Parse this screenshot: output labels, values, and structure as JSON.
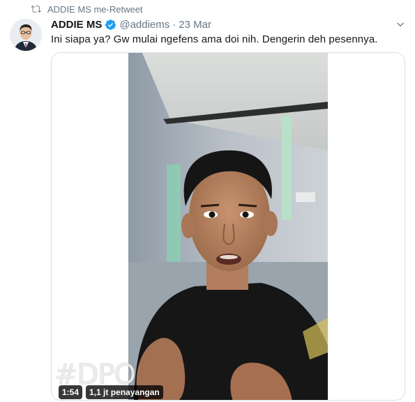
{
  "retweet": {
    "label": "ADDIE MS me-Retweet",
    "icon": "retweet-icon"
  },
  "tweet": {
    "display_name": "ADDIE MS",
    "verified": true,
    "handle": "@addiems",
    "separator": "·",
    "date": "23 Mar",
    "text": "Ini siapa ya? Gw mulai ngefens ama doi nih. Dengerin deh pesennya."
  },
  "media": {
    "watermark": "#DPO",
    "duration": "1:54",
    "views": "1,1 jt penayangan"
  },
  "colors": {
    "muted": "#657786",
    "verified_blue": "#1da1f2",
    "text": "#14171a"
  }
}
